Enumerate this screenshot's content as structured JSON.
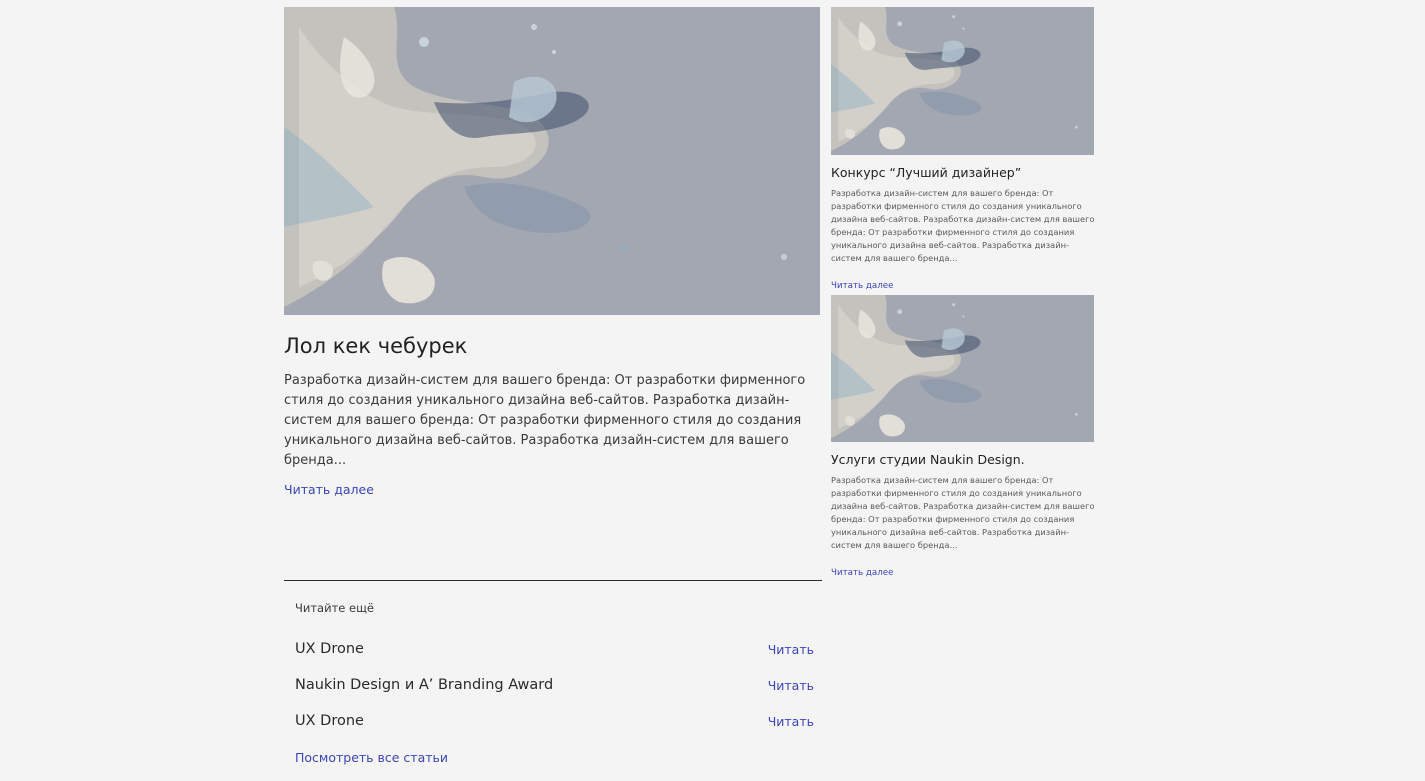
{
  "main_article": {
    "image_icon": "satellite-coastline-image",
    "title": "Лол кек чебурек",
    "excerpt": "Разработка дизайн-систем для вашего бренда: От разработки фирменного стиля до создания уникального дизайна веб-сайтов. Разработка дизайн-систем для вашего бренда: От разработки фирменного стиля до создания уникального дизайна веб-сайтов. Разработка дизайн-систем для вашего бренда...",
    "read_more": "Читать далее"
  },
  "side_articles": [
    {
      "image_icon": "satellite-coastline-image",
      "title": "Конкурс “Лучший дизайнер”",
      "excerpt": "Разработка дизайн-систем для вашего бренда: От разработки фирменного стиля до создания уникального дизайна веб-сайтов. Разработка дизайн-систем для вашего бренда: От разработки фирменного стиля до создания уникального дизайна веб-сайтов. Разработка дизайн-систем для вашего бренда...",
      "read_more": "Читать далее"
    },
    {
      "image_icon": "satellite-coastline-image",
      "title": "Услуги студии Naukin Design.",
      "excerpt": "Разработка дизайн-систем для вашего бренда: От разработки фирменного стиля до создания уникального дизайна веб-сайтов. Разработка дизайн-систем для вашего бренда: От разработки фирменного стиля до создания уникального дизайна веб-сайтов. Разработка дизайн-систем для вашего бренда...",
      "read_more": "Читать далее"
    }
  ],
  "read_more_section": {
    "heading": "Читайте ещё",
    "items": [
      {
        "title": "UX Drone",
        "link": "Читать"
      },
      {
        "title": "Naukin Design и A’ Branding Award",
        "link": "Читать"
      },
      {
        "title": "UX Drone",
        "link": "Читать"
      }
    ],
    "all_articles": "Посмотреть все статьи"
  },
  "colors": {
    "background": "#f4f4f4",
    "link": "#3b46b8",
    "image_overlay": "#a5a9b3"
  }
}
